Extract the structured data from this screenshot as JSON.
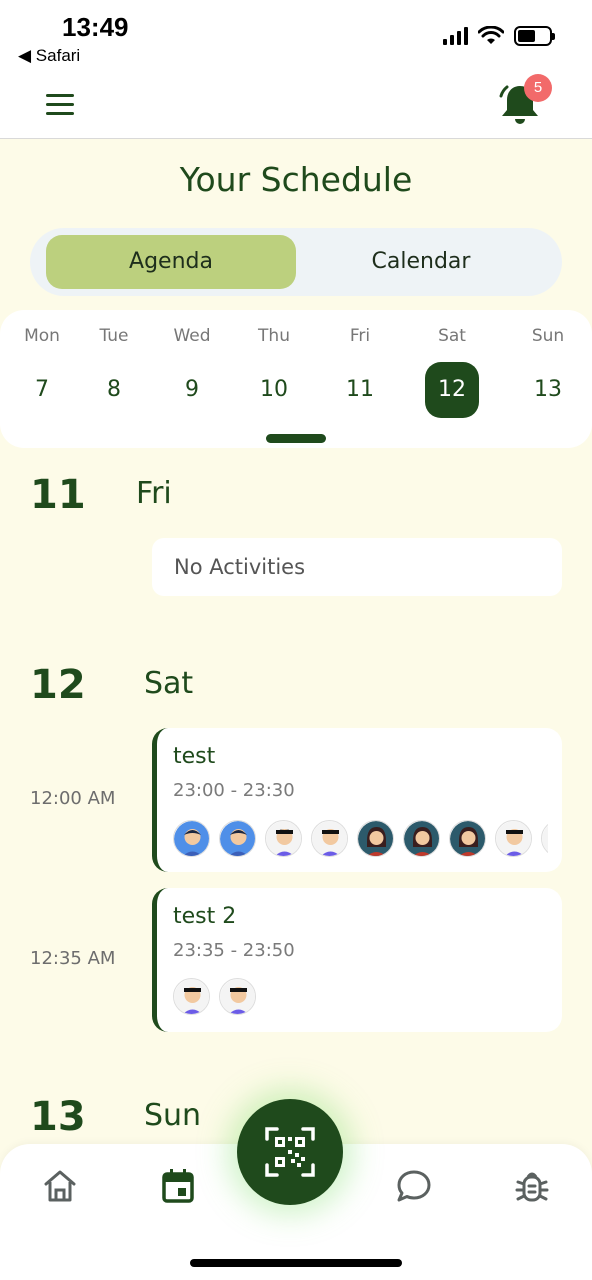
{
  "status": {
    "time": "13:49",
    "back": "◀ Safari"
  },
  "header": {
    "notification_count": "5"
  },
  "page": {
    "title": "Your Schedule"
  },
  "view_toggle": {
    "agenda": "Agenda",
    "calendar": "Calendar",
    "selected": "Agenda"
  },
  "week": {
    "days": [
      {
        "name": "Mon",
        "num": "7"
      },
      {
        "name": "Tue",
        "num": "8"
      },
      {
        "name": "Wed",
        "num": "9"
      },
      {
        "name": "Thu",
        "num": "10"
      },
      {
        "name": "Fri",
        "num": "11"
      },
      {
        "name": "Sat",
        "num": "12"
      },
      {
        "name": "Sun",
        "num": "13"
      }
    ],
    "selected": "12"
  },
  "agenda": {
    "day11": {
      "num": "11",
      "name": "Fri",
      "empty": "No Activities"
    },
    "day12": {
      "num": "12",
      "name": "Sat",
      "events": [
        {
          "time_label": "12:00 AM",
          "title": "test",
          "range": "23:00 - 23:30",
          "attendees": 9
        },
        {
          "time_label": "12:35 AM",
          "title": "test 2",
          "range": "23:35 - 23:50",
          "attendees": 2
        }
      ]
    },
    "day13": {
      "num": "13",
      "name": "Sun"
    }
  },
  "colors": {
    "primary": "#1f4a1c",
    "accent": "#bcd07e",
    "background": "#fdfbe8",
    "badge": "#f26a6a"
  },
  "bottom_nav": {
    "icons": [
      "home-icon",
      "calendar-icon",
      "qr-code-icon",
      "chat-icon",
      "bug-icon"
    ],
    "active": "calendar-icon"
  }
}
